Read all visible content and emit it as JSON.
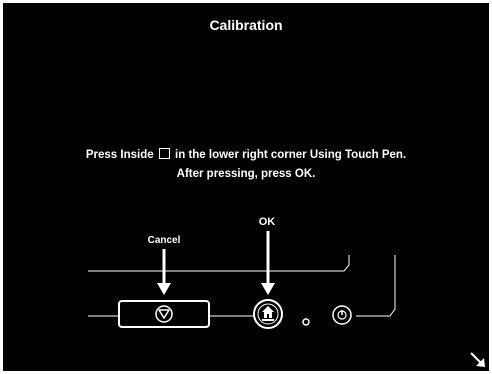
{
  "title": "Calibration",
  "instruction": {
    "before_box": "Press Inside",
    "after_box": "in the lower right corner Using Touch Pen.",
    "line2": "After pressing, press OK."
  },
  "labels": {
    "cancel": "Cancel",
    "ok": "OK"
  },
  "icons": {
    "cancel_button": "stop-icon",
    "home_button": "home-icon",
    "small_button": "small-circle-icon",
    "power_button": "power-icon",
    "corner_arrow": "arrow-down-right-icon"
  },
  "colors": {
    "background": "#000000",
    "foreground": "#ffffff"
  }
}
